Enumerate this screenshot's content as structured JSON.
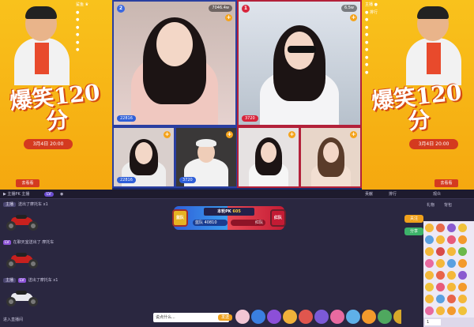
{
  "poster": {
    "title": "爆笑120分",
    "date": "3月4日 20:00",
    "tag": "去看看",
    "left_list": [
      "鲨鱼 ♛",
      "●",
      "●",
      "●",
      "●",
      "●",
      "●",
      "●",
      "●"
    ],
    "right_list": [
      "主播 ●",
      "● 排行",
      "●",
      "●",
      "●",
      "●",
      "●",
      "●",
      "●",
      "●",
      "●",
      "●",
      "●",
      "●",
      "●",
      "●",
      "●",
      "●",
      "●",
      "●",
      "●",
      "●",
      "●"
    ]
  },
  "streams": [
    {
      "num": "2",
      "info": "7046.4w",
      "score": "22816",
      "side": "blue"
    },
    {
      "num": "1",
      "info": "6.5w",
      "score": "3720",
      "side": "red"
    },
    {
      "num": "",
      "info": "",
      "score": "22816",
      "side": "blue"
    },
    {
      "num": "",
      "info": "",
      "score": "3720",
      "side": "blue"
    },
    {
      "num": "",
      "info": "",
      "score": "",
      "side": "red"
    },
    {
      "num": "",
      "info": "",
      "score": "",
      "side": "red"
    }
  ],
  "statusbar": {
    "left": "▶ 主播PK 主播",
    "pill": "LV",
    "mid": "◉",
    "right1": "贡献",
    "right2": "排行",
    "right3": "观众"
  },
  "chat": {
    "rows": [
      {
        "user": "主播",
        "lvl": "",
        "text": "送出了摩托车 x1"
      },
      {
        "user": "",
        "lvl": "LV",
        "text": "在聊天室送出了 摩托车"
      },
      {
        "user": "主播",
        "lvl": "LV",
        "text": "送出了摩托车 x1"
      },
      {
        "user": "",
        "lvl": "",
        "text": "进入直播间"
      }
    ]
  },
  "pk": {
    "left_shield": "蓝队",
    "right_shield": "红队",
    "center": "本轮PK",
    "center_num": "605",
    "left_score": "蓝队 40810",
    "right_score": "红队"
  },
  "tray": {
    "input_placeholder": "说点什么...",
    "send": "发送",
    "gifts": [
      "",
      "",
      "",
      "",
      "",
      "",
      "",
      "",
      "",
      "",
      "",
      "",
      "",
      "",
      ""
    ]
  },
  "rpanel": {
    "btn1": "关注",
    "btn2": "分享",
    "tab1": "礼物",
    "tab2": "背包",
    "count": "1"
  },
  "colors": {
    "blue_team": "#2f5fd8",
    "red_team": "#d8253c",
    "poster": "#f5b713"
  }
}
